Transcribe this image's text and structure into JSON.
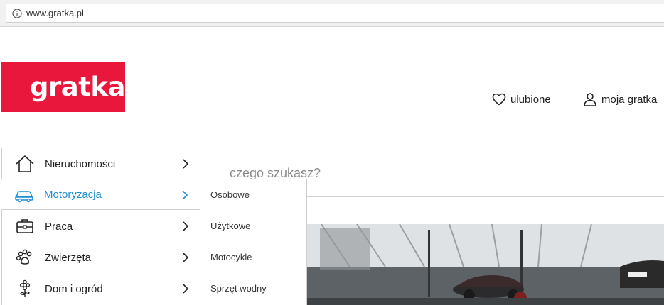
{
  "browser": {
    "url": "www.gratka.pl"
  },
  "header": {
    "logo_text": "gratka",
    "favorites_label": "ulubione",
    "account_label": "moja gratka"
  },
  "search": {
    "placeholder": "czego szukasz?"
  },
  "categories": [
    {
      "label": "Nieruchomości",
      "icon": "house-icon",
      "active": false
    },
    {
      "label": "Motoryzacja",
      "icon": "car-icon",
      "active": true
    },
    {
      "label": "Praca",
      "icon": "briefcase-icon",
      "active": false
    },
    {
      "label": "Zwierzęta",
      "icon": "paw-icon",
      "active": false
    },
    {
      "label": "Dom i ogród",
      "icon": "flower-icon",
      "active": false
    }
  ],
  "submenu": {
    "items": [
      "Osobowe",
      "Użytkowe",
      "Motocykle",
      "Sprzęt wodny"
    ]
  },
  "colors": {
    "brand": "#e8173b",
    "active": "#1f8fd6"
  }
}
